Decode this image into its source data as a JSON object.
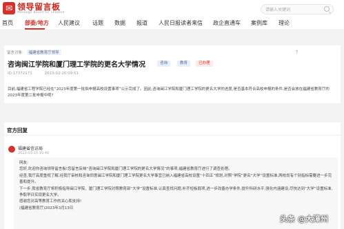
{
  "header": {
    "brand": "领导留言板",
    "brand_sub": "Message Board for Leaders",
    "search_placeholder": "请输入关键词"
  },
  "nav": {
    "items": [
      "首页",
      "部委/地方",
      "人民建议",
      "话题",
      "数据",
      "报道",
      "人民日报读者来信",
      "政企直通车",
      "案例库",
      "理论"
    ]
  },
  "message": {
    "crumb_label": "留言对象:",
    "crumb_target": "福建省教育厅领导",
    "icons": "↑",
    "title": "咨询闽江学院和厦门理工学院的更名大学情况",
    "tags": [
      "咨询",
      "教育",
      "已办理"
    ],
    "id": "ID:17372171",
    "time": "2023-02-20 09:51",
    "body": "目前,福建省工程学院已经在“2023年度第一批拟申报高校设置事项”公示完成了。因此,咨询闽江学院和厦门理工学院的更名大学的进度,是否基本符合高校申报的条件,是否会放在福建省教育厅的2023年度第二批申报中呢?"
  },
  "reply": {
    "section_title": "官方回复",
    "org": "福建省信访局",
    "date": "2023-03-15 15:40",
    "paragraphs": [
      "网友:",
      "您好,欢迎你咨询领导留言板!您留言反映“咨询闽江学院和厦门理工学院的更名大学情况”的事项,福建省教育厅进行了调查处理。",
      "经查,我厅高度重视了解,经我厅审核和咨询同意闽江学院和厦门理工学院更名大学事宜已纳入福建省高校设置“十四五”规划,对照“学院”更名“大学”设置标准,两校尚有个别指标需要进一步完善和提升。",
      "下一步,我省教育厅将积极指导闽江学院、厦门理工学院对照教育部“大学”设置标准,认真查找问题,补齐短板弱项,进一步改善办学条件,提升科研水平,强化内涵建设,尽快达到“大学”设置标准,争取早日实现更名大学。",
      "感谢您对高等教育工作的关心和支持!",
      "(福建省教育厅)2023年3月13日"
    ]
  },
  "watermark": "头条 @大漳州"
}
